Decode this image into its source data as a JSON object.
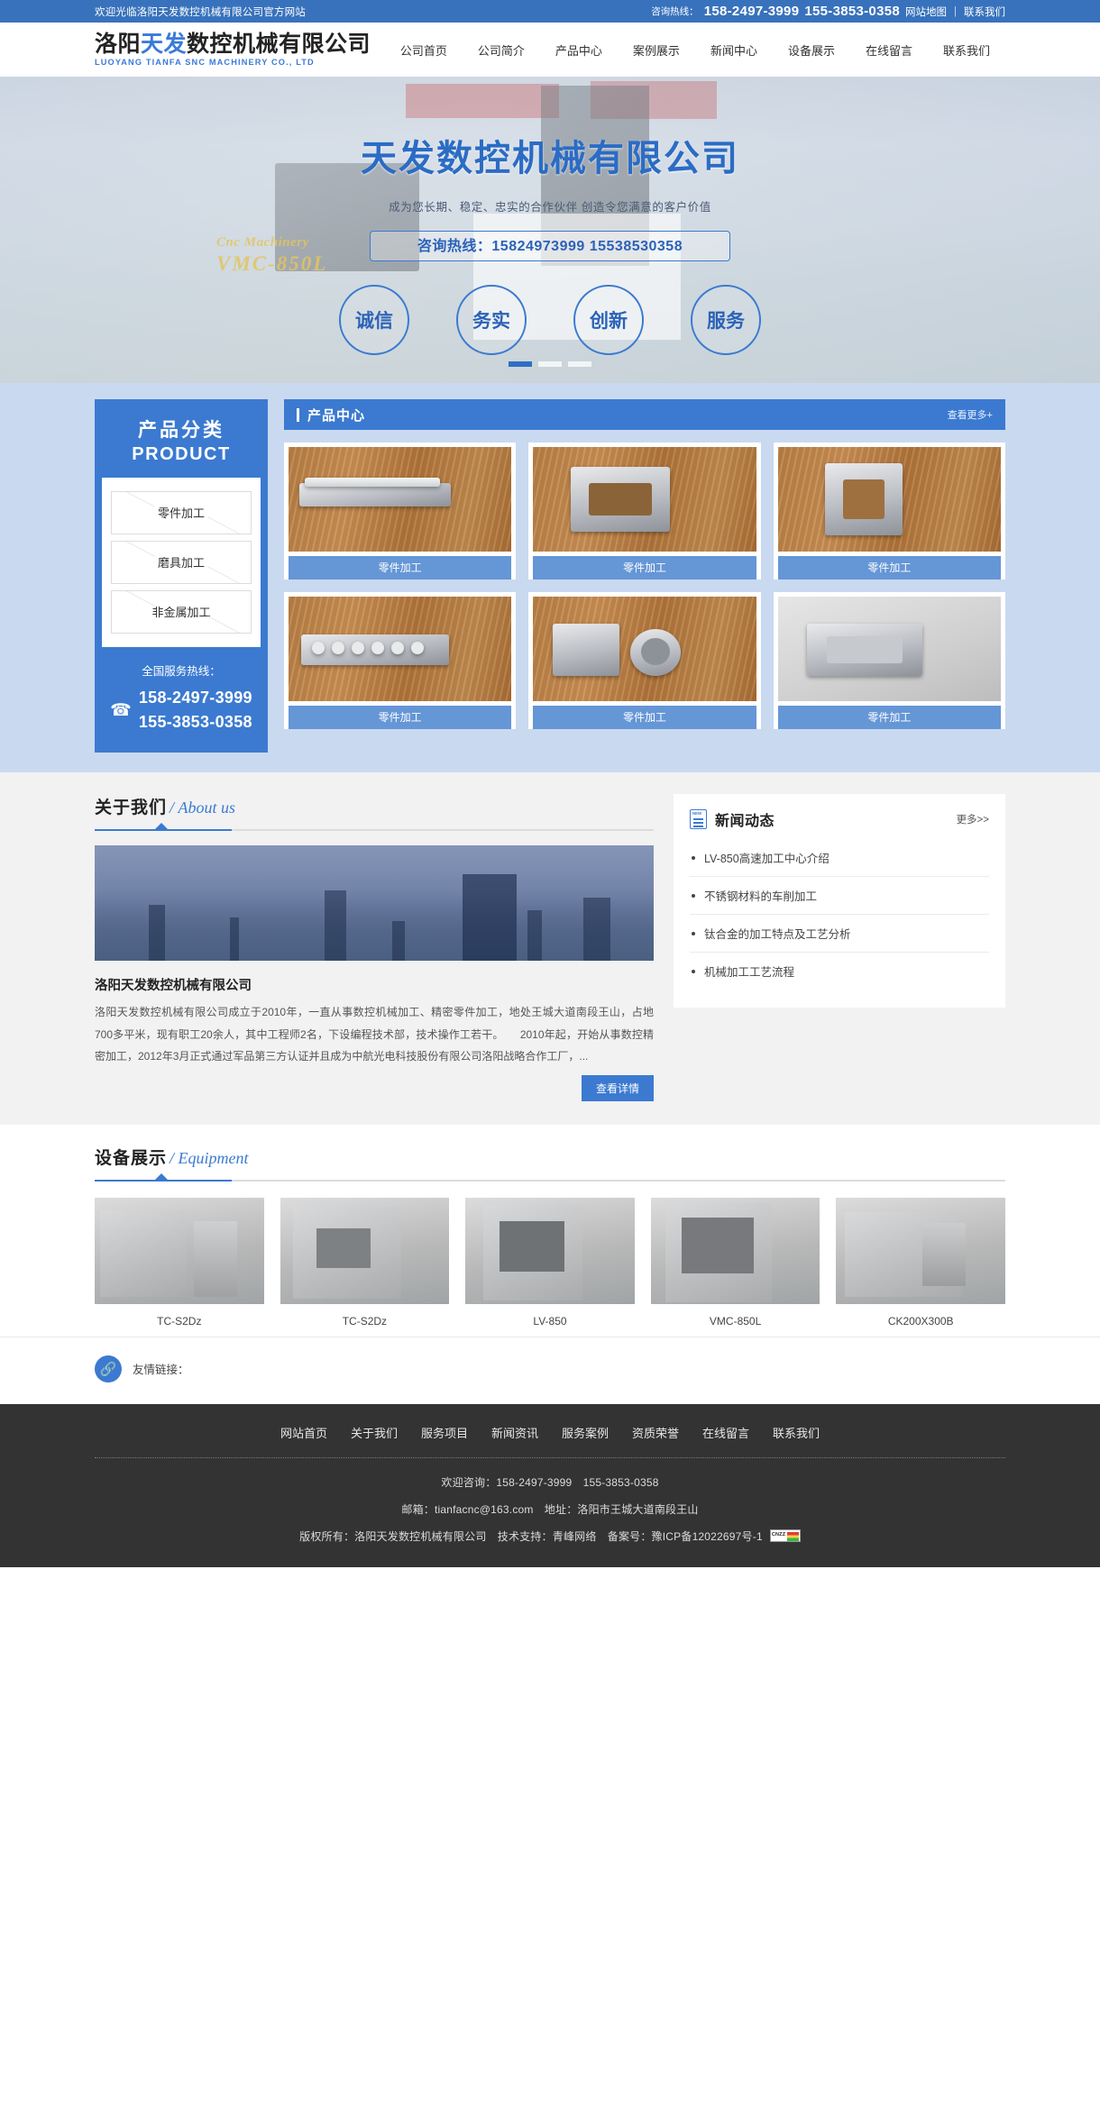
{
  "topbar": {
    "welcome": "欢迎光临洛阳天发数控机械有限公司官方网站",
    "hotline_label": "咨询热线：",
    "phone1": "158-2497-3999",
    "phone2": "155-3853-0358",
    "sitemap": "网站地图",
    "separator": "|",
    "contact": "联系我们"
  },
  "header": {
    "logo_part1": "洛阳",
    "logo_highlight": "天发",
    "logo_part2": "数控机械有限公司",
    "logo_en": "LUOYANG TIANFA SNC MACHINERY CO., LTD",
    "nav": [
      {
        "label": "公司首页"
      },
      {
        "label": "公司简介"
      },
      {
        "label": "产品中心"
      },
      {
        "label": "案例展示"
      },
      {
        "label": "新闻中心"
      },
      {
        "label": "设备展示"
      },
      {
        "label": "在线留言"
      },
      {
        "label": "联系我们"
      }
    ]
  },
  "banner": {
    "machine_label_line1": "Cnc Machinery",
    "machine_label_line2": "VMC-850L",
    "title": "天发数控机械有限公司",
    "subtitle": "成为您长期、稳定、忠实的合作伙伴 创造令您满意的客户价值",
    "hotline": "咨询热线：15824973999  15538530358",
    "values": [
      "诚信",
      "务实",
      "创新",
      "服务"
    ],
    "dots": [
      true,
      false,
      false
    ]
  },
  "product": {
    "category_title_cn": "产品分类",
    "category_title_en": "PRODUCT",
    "categories": [
      {
        "label": "零件加工"
      },
      {
        "label": "磨具加工"
      },
      {
        "label": "非金属加工"
      }
    ],
    "hotline_label": "全国服务热线：",
    "hotline_1": "158-2497-3999",
    "hotline_2": "155-3853-0358",
    "panel_title": "产品中心",
    "more": "查看更多+",
    "items": [
      {
        "caption": "零件加工"
      },
      {
        "caption": "零件加工"
      },
      {
        "caption": "零件加工"
      },
      {
        "caption": "零件加工"
      },
      {
        "caption": "零件加工"
      },
      {
        "caption": "零件加工"
      }
    ]
  },
  "about": {
    "title_cn": "关于我们",
    "title_en": "/ About us",
    "company_name": "洛阳天发数控机械有限公司",
    "description": "洛阳天发数控机械有限公司成立于2010年，一直从事数控机械加工、精密零件加工，地处王城大道南段王山，占地700多平米，现有职工20余人，其中工程师2名，下设编程技术部，技术操作工若干。　　2010年起，开始从事数控精密加工，2012年3月正式通过军品第三方认证并且成为中航光电科技股份有限公司洛阳战略合作工厂，...",
    "button": "查看详情"
  },
  "news": {
    "title": "新闻动态",
    "more": "更多>>",
    "items": [
      {
        "title": "LV-850高速加工中心介绍"
      },
      {
        "title": "不锈钢材料的车削加工"
      },
      {
        "title": "钛合金的加工特点及工艺分析"
      },
      {
        "title": "机械加工工艺流程"
      }
    ]
  },
  "equipment": {
    "title_cn": "设备展示",
    "title_en": "/ Equipment",
    "items": [
      {
        "label": "TC-S2Dz"
      },
      {
        "label": "TC-S2Dz"
      },
      {
        "label": "LV-850"
      },
      {
        "label": "VMC-850L"
      },
      {
        "label": "CK200X300B"
      }
    ]
  },
  "friend_links": {
    "label": "友情链接："
  },
  "footer": {
    "nav": [
      {
        "label": "网站首页"
      },
      {
        "label": "关于我们"
      },
      {
        "label": "服务项目"
      },
      {
        "label": "新闻资讯"
      },
      {
        "label": "服务案例"
      },
      {
        "label": "资质荣誉"
      },
      {
        "label": "在线留言"
      },
      {
        "label": "联系我们"
      }
    ],
    "line_phone": "欢迎咨询：158-2497-3999　155-3853-0358",
    "line_contact": "邮箱：tianfacnc@163.com　地址：洛阳市王城大道南段王山",
    "line_copyright": "版权所有：洛阳天发数控机械有限公司　技术支持：青峰网络　备案号：豫ICP备12022697号-1"
  },
  "colors": {
    "brand_blue": "#3b7ad0",
    "top_blue": "#3872bc",
    "product_bg": "#c9d9ef",
    "footer_bg": "#333333"
  }
}
